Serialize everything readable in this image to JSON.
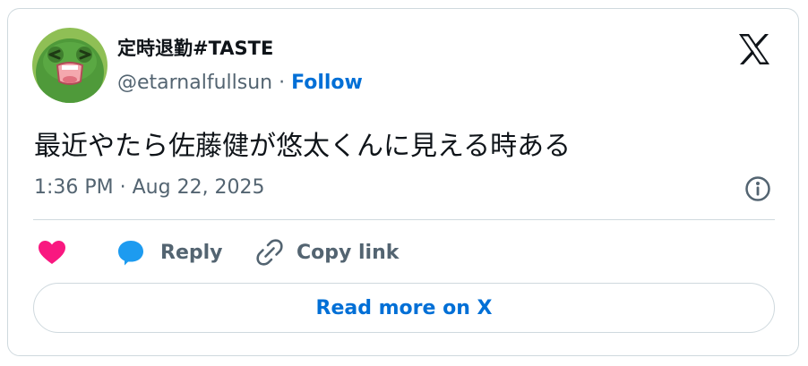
{
  "author": {
    "display_name": "定時退勤#TASTE",
    "handle": "@etarnalfullsun",
    "separator": " · ",
    "follow_label": "Follow"
  },
  "tweet": {
    "text": "最近やたら佐藤健が悠太くんに見える時ある",
    "timestamp": "1:36 PM · Aug 22, 2025"
  },
  "actions": {
    "reply_label": "Reply",
    "copy_link_label": "Copy link"
  },
  "read_more_label": "Read more on X",
  "icons": {
    "brand": "x-logo-icon",
    "info": "info-icon",
    "like": "heart-icon",
    "reply": "speech-bubble-icon",
    "copy": "link-icon"
  },
  "colors": {
    "link": "#006fd6",
    "like": "#f91880",
    "reply": "#1d9bf0",
    "muted": "#536471",
    "text": "#0f1419",
    "border": "#cfd9de"
  }
}
